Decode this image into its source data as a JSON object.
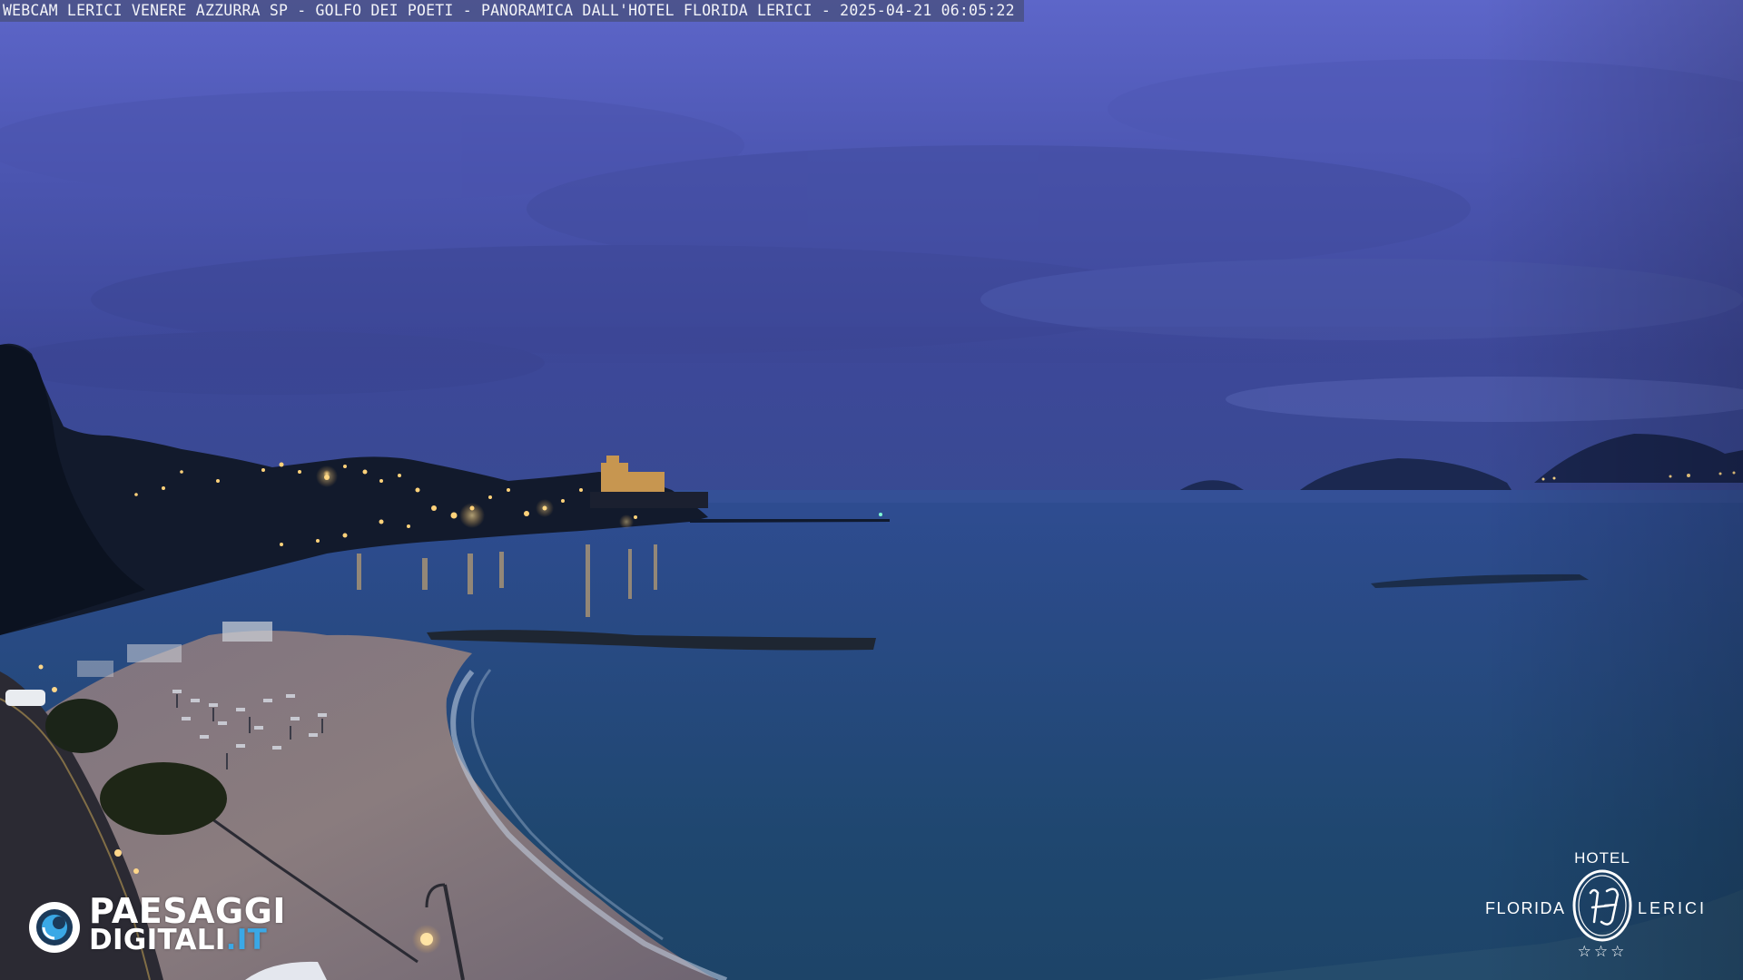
{
  "caption": {
    "text": "WEBCAM LERICI VENERE AZZURRA SP - GOLFO DEI POETI - PANORAMICA DALL'HOTEL FLORIDA LERICI - 2025-04-21 06:05:22"
  },
  "paesaggi_logo": {
    "line1": "PAESAGGI",
    "line2_main": "DIGITALI",
    "line2_tld": ".IT",
    "icon": "camera-lens-icon"
  },
  "hotel_logo": {
    "word_hotel": "HOTEL",
    "word_left": "FLORIDA",
    "word_right": "LERICI",
    "monogram": "HF",
    "stars": "☆☆☆",
    "icon": "hotel-monogram-seal"
  },
  "colors": {
    "sky_top": "#5a63c4",
    "sky_horizon": "#3f4ea3",
    "sea_far": "#2b4a8a",
    "sea_near": "#1f4a6e",
    "beach": "#8a7d80",
    "lights": "#ffd27a",
    "logo_accent": "#3aa8e6"
  }
}
